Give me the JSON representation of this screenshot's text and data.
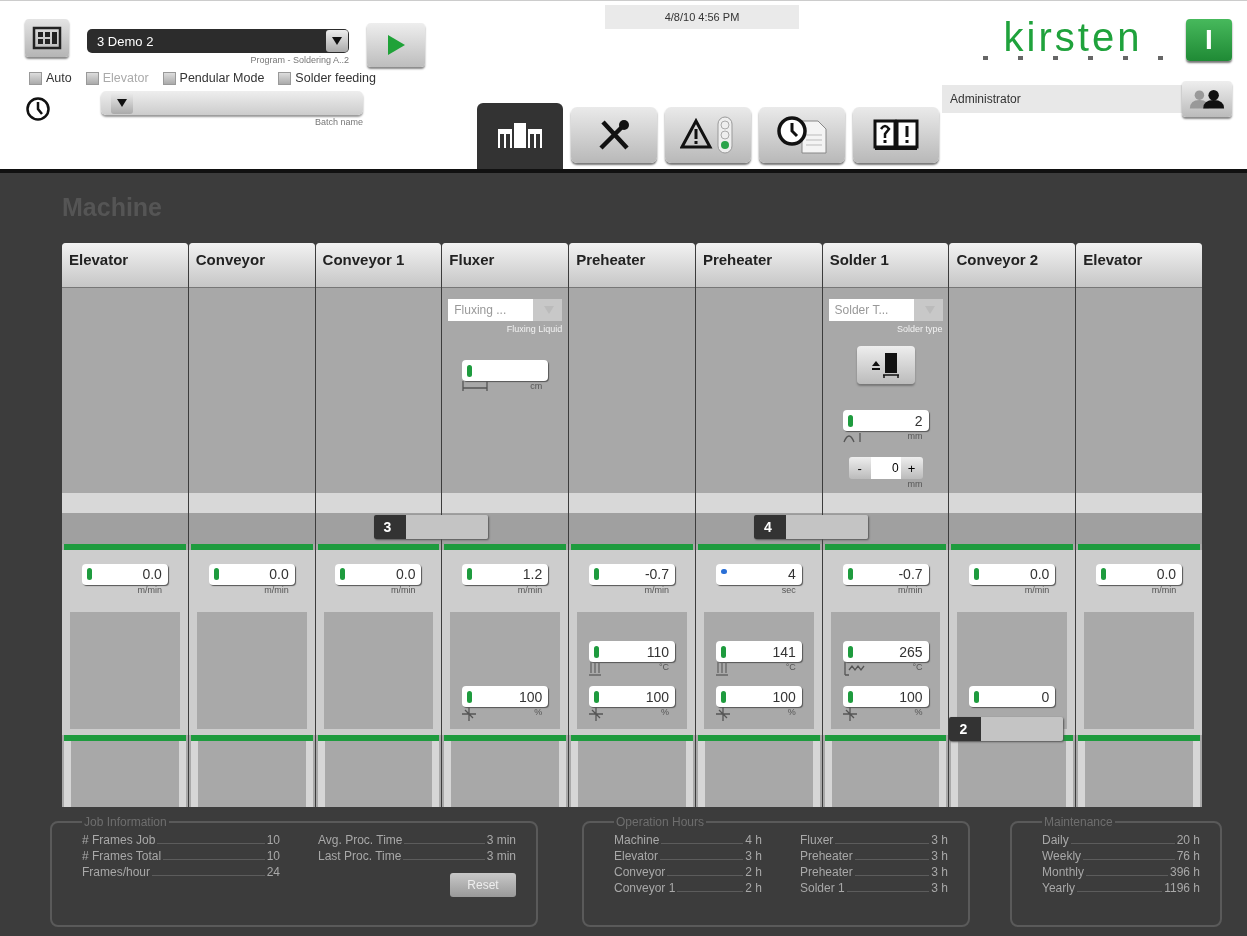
{
  "header": {
    "program": {
      "value": "3  Demo 2",
      "caption": "Program - Soldering A..2"
    },
    "checkboxes": [
      {
        "label": "Auto",
        "checked": false,
        "disabled": false
      },
      {
        "label": "Elevator",
        "checked": false,
        "disabled": true
      },
      {
        "label": "Pendular Mode",
        "checked": false,
        "disabled": false
      },
      {
        "label": "Solder feeding",
        "checked": false,
        "disabled": false
      }
    ],
    "batch": {
      "caption": "Batch name"
    },
    "datetime": "4/8/10 4:56 PM",
    "logo": "kirsten",
    "power_button": {
      "label": "I",
      "on": true
    },
    "tabs": [
      {
        "kind": "machine",
        "selected": true
      },
      {
        "kind": "tools",
        "selected": false
      },
      {
        "kind": "alarms",
        "selected": false
      },
      {
        "kind": "log",
        "selected": false
      },
      {
        "kind": "help",
        "selected": false
      }
    ],
    "user": "Administrator"
  },
  "title": "Machine",
  "stations": [
    {
      "name": "Elevator",
      "speed": {
        "kind": "speed",
        "value": "0.0",
        "unit": "m/min",
        "color": "#1e9b3e"
      }
    },
    {
      "name": "Conveyor",
      "speed": {
        "kind": "speed",
        "value": "0.0",
        "unit": "m/min",
        "color": "#1e9b3e"
      }
    },
    {
      "name": "Conveyor 1",
      "speed": {
        "kind": "speed",
        "value": "0.0",
        "unit": "m/min",
        "color": "#1e9b3e"
      },
      "marker": {
        "label": "3",
        "kind": "upper"
      }
    },
    {
      "name": "Fluxer",
      "upper": [
        {
          "kind": "dropdown",
          "value": "Fluxing ...",
          "caption": "Fluxing Liquid"
        },
        {
          "kind": "width",
          "unit": "cm",
          "color": "#1e9b3e"
        }
      ],
      "speed": {
        "kind": "speed",
        "value": "1.2",
        "unit": "m/min",
        "color": "#1e9b3e"
      },
      "lower": [
        {
          "kind": "fan",
          "value": "100",
          "unit": "%",
          "color": "#1e9b3e"
        }
      ]
    },
    {
      "name": "Preheater",
      "speed": {
        "kind": "speed",
        "value": "-0.7",
        "unit": "m/min",
        "color": "#1e9b3e"
      },
      "lower": [
        {
          "kind": "heater",
          "value": "110",
          "unit": "°C",
          "color": "#1e9b3e"
        },
        {
          "kind": "fan",
          "value": "100",
          "unit": "%",
          "color": "#1e9b3e"
        }
      ]
    },
    {
      "name": "Preheater",
      "speed": {
        "kind": "time",
        "value": "4",
        "unit": "sec",
        "color": "#2a6fd6"
      },
      "lower": [
        {
          "kind": "heater",
          "value": "141",
          "unit": "°C",
          "color": "#1e9b3e"
        },
        {
          "kind": "fan",
          "value": "100",
          "unit": "%",
          "color": "#1e9b3e"
        }
      ],
      "marker": {
        "label": "4",
        "kind": "upper"
      }
    },
    {
      "name": "Solder 1",
      "upper": [
        {
          "kind": "dropdown",
          "value": "Solder T...",
          "caption": "Solder type"
        },
        {
          "kind": "eject"
        },
        {
          "kind": "height",
          "value": "2",
          "unit": "mm",
          "color": "#1e9b3e"
        },
        {
          "kind": "stepper",
          "minus": "-",
          "value": "0",
          "plus": "+",
          "unit": "mm"
        }
      ],
      "speed": {
        "kind": "speed",
        "value": "-0.7",
        "unit": "m/min",
        "color": "#1e9b3e"
      },
      "lower": [
        {
          "kind": "wave",
          "value": "265",
          "unit": "°C",
          "color": "#1e9b3e"
        },
        {
          "kind": "fan",
          "value": "100",
          "unit": "%",
          "color": "#1e9b3e"
        }
      ]
    },
    {
      "name": "Conveyor 2",
      "speed": {
        "kind": "speed",
        "value": "0.0",
        "unit": "m/min",
        "color": "#1e9b3e"
      },
      "lower": [
        {
          "kind": "plain",
          "value": "0",
          "color": "#1e9b3e"
        }
      ],
      "marker": {
        "label": "2",
        "kind": "lower"
      }
    },
    {
      "name": "Elevator",
      "speed": {
        "kind": "speed",
        "value": "0.0",
        "unit": "m/min",
        "color": "#1e9b3e"
      }
    }
  ],
  "job_information": {
    "title": "Job Information",
    "columns": [
      [
        {
          "label": "# Frames Job",
          "value": "10"
        },
        {
          "label": "# Frames Total",
          "value": "10"
        },
        {
          "label": "Frames/hour",
          "value": "24"
        }
      ],
      [
        {
          "label": "Avg. Proc. Time",
          "value": "3 min"
        },
        {
          "label": "Last Proc. Time",
          "value": "3 min"
        }
      ]
    ],
    "button": "Reset"
  },
  "operation_hours": {
    "title": "Operation Hours",
    "columns": [
      [
        {
          "label": "Machine",
          "value": "4 h"
        },
        {
          "label": "Elevator",
          "value": "3 h"
        },
        {
          "label": "Conveyor",
          "value": "2 h"
        },
        {
          "label": "Conveyor 1",
          "value": "2 h"
        }
      ],
      [
        {
          "label": "Fluxer",
          "value": "3 h"
        },
        {
          "label": "Preheater",
          "value": "3 h"
        },
        {
          "label": "Preheater",
          "value": "3 h"
        },
        {
          "label": "Solder 1",
          "value": "3 h"
        }
      ]
    ]
  },
  "maintenance": {
    "title": "Maintenance",
    "columns": [
      [
        {
          "label": "Daily",
          "value": "20 h"
        },
        {
          "label": "Weekly",
          "value": "76 h"
        },
        {
          "label": "Monthly",
          "value": "396 h"
        },
        {
          "label": "Yearly",
          "value": "1196 h"
        }
      ]
    ]
  }
}
